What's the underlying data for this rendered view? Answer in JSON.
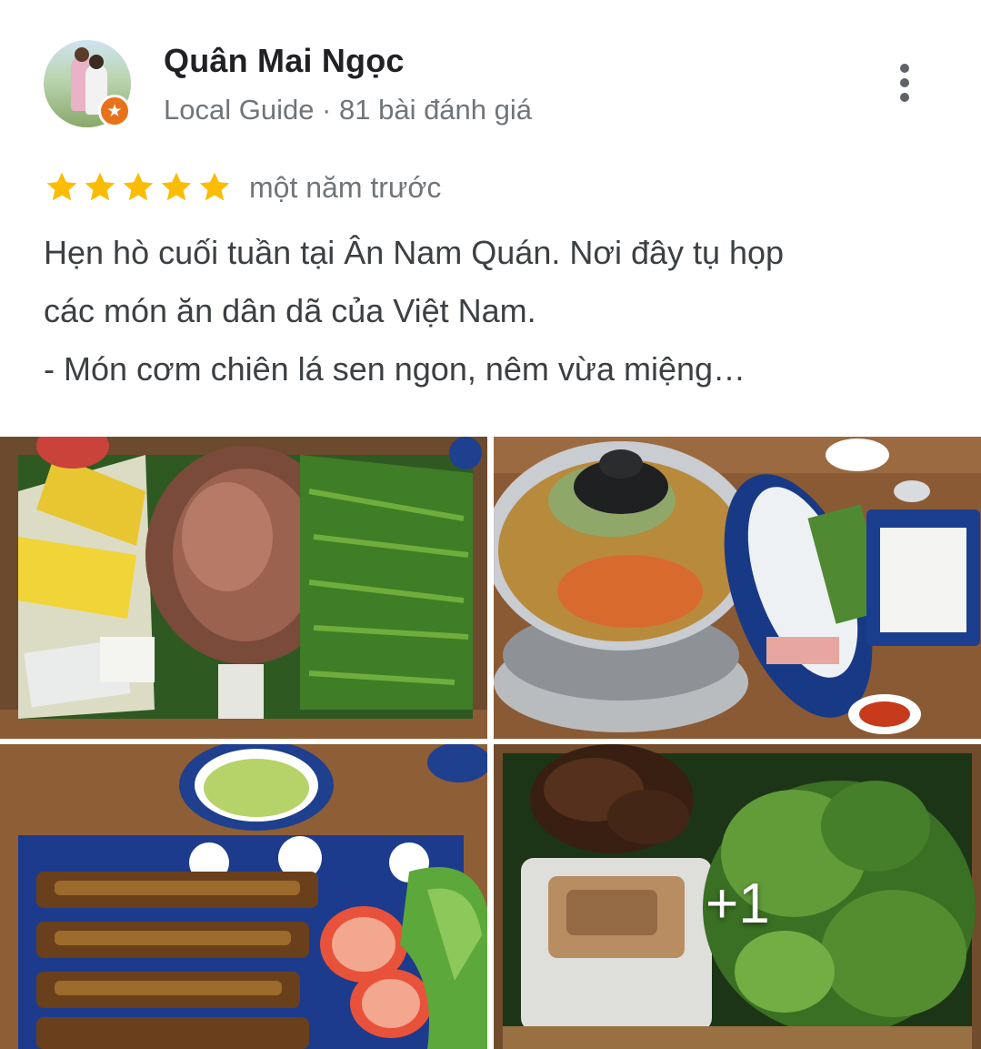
{
  "reviewer": {
    "name": "Quân Mai Ngọc",
    "subline": "Local Guide · 81 bài đánh giá",
    "avatar_icon": "person-avatar",
    "badge_icon": "local-guide-star-icon",
    "badge_color": "#e8711a"
  },
  "rating": {
    "stars": 5,
    "star_color": "#fbbc04",
    "time": "một năm trước"
  },
  "review": {
    "lines": [
      "Hẹn hò cuối tuần tại Ân Nam Quán. Nơi đây tụ họp",
      "các món ăn dân dã của Việt Nam.",
      "- Món cơm chiên lá sen ngon, nêm vừa miệng…"
    ]
  },
  "photos": {
    "items": [
      {
        "name": "vegetable-platter-photo"
      },
      {
        "name": "hotpot-photo"
      },
      {
        "name": "grilled-skewers-photo"
      },
      {
        "name": "grilled-meat-rice-paper-photo"
      }
    ],
    "more_count": "+1"
  },
  "menu": {
    "icon": "more-vert-icon"
  }
}
